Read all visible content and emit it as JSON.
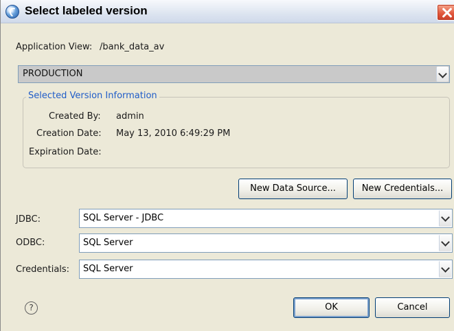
{
  "window": {
    "title": "Select labeled version"
  },
  "application_view": {
    "label": "Application View:",
    "value": "/bank_data_av"
  },
  "version_select": {
    "selected": "PRODUCTION"
  },
  "version_info": {
    "group_title": "Selected Version Information",
    "created_by_label": "Created By:",
    "created_by_value": "admin",
    "creation_date_label": "Creation Date:",
    "creation_date_value": "May 13, 2010 6:49:29 PM",
    "expiration_date_label": "Expiration Date:",
    "expiration_date_value": ""
  },
  "actions": {
    "new_data_source": "New Data Source...",
    "new_credentials": "New Credentials..."
  },
  "jdbc": {
    "label": "JDBC:",
    "value": "SQL Server - JDBC"
  },
  "odbc": {
    "label": "ODBC:",
    "value": "SQL Server"
  },
  "credentials": {
    "label": "Credentials:",
    "value": "SQL Server"
  },
  "footer": {
    "help_glyph": "?",
    "ok": "OK",
    "cancel": "Cancel"
  },
  "icons": {
    "app": "app-globe-icon",
    "close": "close-icon",
    "help": "help-icon",
    "dropdown": "chevron-down-icon"
  },
  "colors": {
    "dialog_bg": "#ece9d8",
    "group_title": "#1f5cc8",
    "close_button": "#e0553a",
    "button_border": "#003c74"
  }
}
